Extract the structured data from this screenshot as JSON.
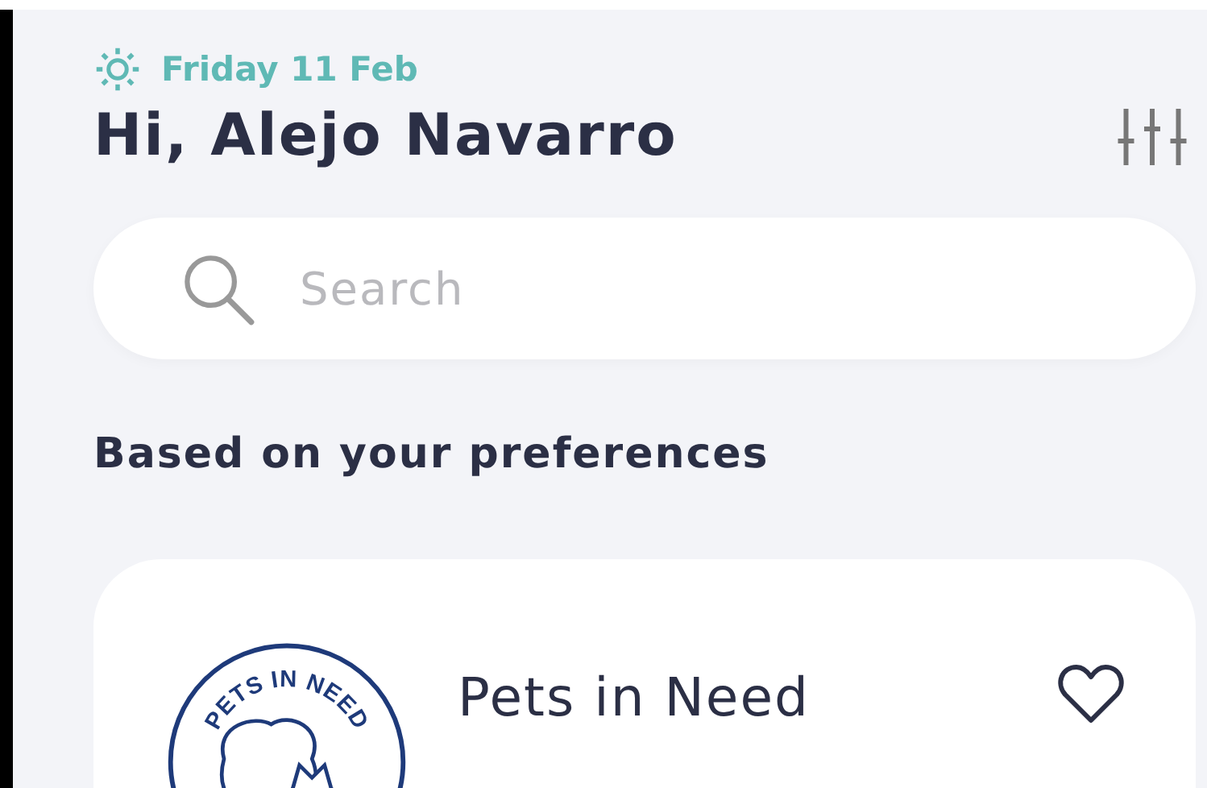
{
  "header": {
    "date": "Friday 11 Feb",
    "greeting": "Hi, Alejo Navarro"
  },
  "search": {
    "placeholder": "Search"
  },
  "section": {
    "title": "Based on your preferences"
  },
  "cards": [
    {
      "logo_text": "PETS IN NEED",
      "name": "Pets in Need",
      "favorite": false
    }
  ]
}
